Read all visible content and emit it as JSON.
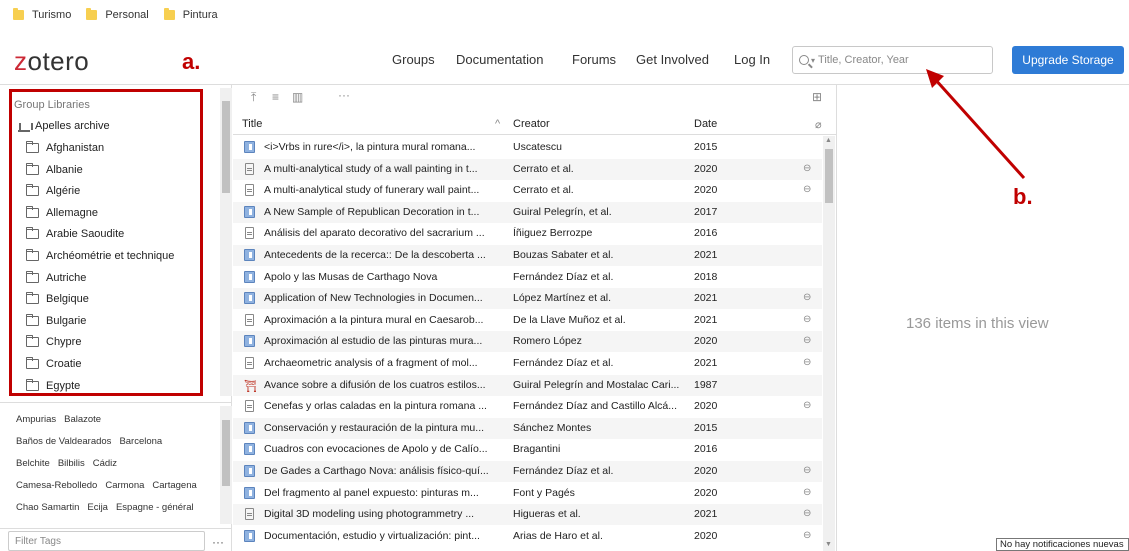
{
  "bookmarks": [
    {
      "label": "Turismo"
    },
    {
      "label": "Personal"
    },
    {
      "label": "Pintura"
    }
  ],
  "header": {
    "logo_z": "z",
    "logo_rest": "otero",
    "nav": [
      "Groups",
      "Documentation",
      "Forums",
      "Get Involved",
      "Log In"
    ],
    "search_placeholder": "Title, Creator, Year",
    "upgrade_label": "Upgrade Storage"
  },
  "annotations": {
    "a": "a.",
    "b": "b."
  },
  "sidebar": {
    "group_label": "Group Libraries",
    "library": "Apelles archive",
    "collections": [
      "Afghanistan",
      "Albanie",
      "Algérie",
      "Allemagne",
      "Arabie Saoudite",
      "Archéométrie et technique",
      "Autriche",
      "Belgique",
      "Bulgarie",
      "Chypre",
      "Croatie",
      "Egypte"
    ]
  },
  "tags": {
    "lines": [
      [
        "Ampurias",
        "Balazote"
      ],
      [
        "Baños de Valdearados",
        "Barcelona"
      ],
      [
        "Belchite",
        "Bilbilis",
        "Cádiz"
      ],
      [
        "Camesa-Rebolledo",
        "Carmona",
        "Cartagena"
      ],
      [
        "Chao Samartin",
        "Ecija",
        "Espagne - général"
      ]
    ],
    "filter_placeholder": "Filter Tags",
    "more": "···"
  },
  "items": {
    "toolbar_more": "···",
    "columns": {
      "title": "Title",
      "creator": "Creator",
      "date": "Date"
    },
    "rows": [
      {
        "icon": "book",
        "title": "<i>Vrbs in rure</i>, la pintura mural romana...",
        "creator": "Uscatescu",
        "date": "2015",
        "link": false
      },
      {
        "icon": "doc",
        "title": "A multi-analytical study of a wall painting in t...",
        "creator": "Cerrato et al.",
        "date": "2020",
        "link": true
      },
      {
        "icon": "doc",
        "title": "A multi-analytical study of funerary wall paint...",
        "creator": "Cerrato et al.",
        "date": "2020",
        "link": true
      },
      {
        "icon": "book",
        "title": "A New Sample of Republican Decoration in t...",
        "creator": "Guiral Pelegrín, et al.",
        "date": "2017",
        "link": false
      },
      {
        "icon": "doc",
        "title": "Análisis del aparato decorativo del sacrarium ...",
        "creator": "Íñiguez Berrozpe",
        "date": "2016",
        "link": false
      },
      {
        "icon": "book",
        "title": "Antecedents de la recerca:: De la descoberta ...",
        "creator": "Bouzas Sabater et al.",
        "date": "2021",
        "link": false
      },
      {
        "icon": "book",
        "title": "Apolo y las Musas de Carthago Nova",
        "creator": "Fernández Díaz et al.",
        "date": "2018",
        "link": false
      },
      {
        "icon": "book",
        "title": "Application of New Technologies in Documen...",
        "creator": "López Martínez et al.",
        "date": "2021",
        "link": true
      },
      {
        "icon": "doc",
        "title": "Aproximación a la pintura mural en Caesarob...",
        "creator": "De la Llave Muñoz et al.",
        "date": "2021",
        "link": true
      },
      {
        "icon": "book",
        "title": "Aproximación al estudio de las pinturas mura...",
        "creator": "Romero López",
        "date": "2020",
        "link": true
      },
      {
        "icon": "doc",
        "title": "Archaeometric analysis of a fragment of mol...",
        "creator": "Fernández Díaz et al.",
        "date": "2021",
        "link": true
      },
      {
        "icon": "paper",
        "title": "Avance sobre a difusión de los cuatros estilos...",
        "creator": "Guiral Pelegrín and Mostalac Cari...",
        "date": "1987",
        "link": false
      },
      {
        "icon": "doc",
        "title": "Cenefas y orlas caladas en la pintura romana ...",
        "creator": "Fernández Díaz and Castillo Alcá...",
        "date": "2020",
        "link": true
      },
      {
        "icon": "book",
        "title": "Conservación y restauración de la pintura mu...",
        "creator": "Sánchez Montes",
        "date": "2015",
        "link": false
      },
      {
        "icon": "book",
        "title": "Cuadros con evocaciones de Apolo y de Calío...",
        "creator": "Bragantini",
        "date": "2016",
        "link": false
      },
      {
        "icon": "book",
        "title": "De Gades a Carthago Nova: análisis físico-quí...",
        "creator": "Fernández Díaz et al.",
        "date": "2020",
        "link": true
      },
      {
        "icon": "book",
        "title": "Del fragmento al panel expuesto: pinturas m...",
        "creator": "Font y Pagés",
        "date": "2020",
        "link": true
      },
      {
        "icon": "doc",
        "title": "Digital 3D modeling using photogrammetry ...",
        "creator": "Higueras et al.",
        "date": "2021",
        "link": true
      },
      {
        "icon": "book",
        "title": "Documentación, estudio y virtualización: pint...",
        "creator": "Arias de Haro et al.",
        "date": "2020",
        "link": true
      }
    ]
  },
  "right_pane": {
    "count_text": "136 items in this view"
  },
  "notification": "No hay notificaciones nuevas"
}
